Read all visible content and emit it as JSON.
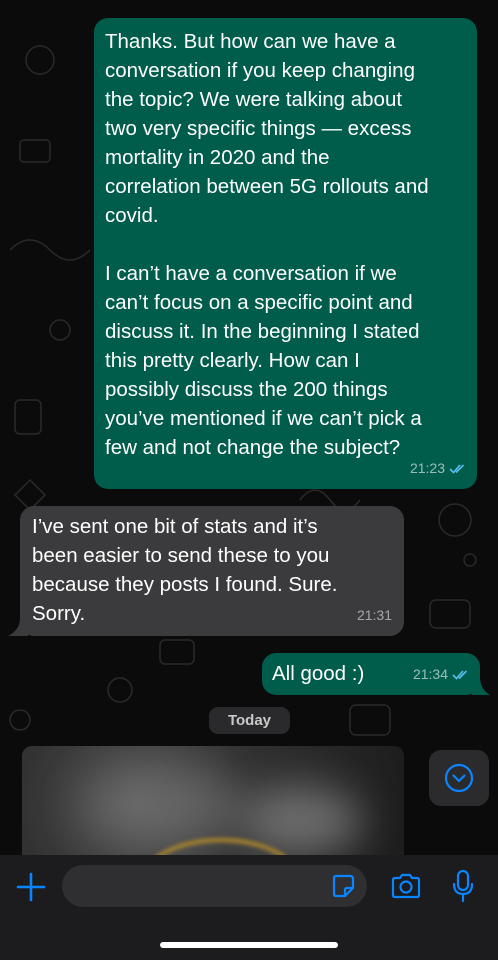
{
  "messages": [
    {
      "direction": "outgoing",
      "text": "Thanks. But how can we have a\nconversation if you keep changing\nthe topic? We were talking about\ntwo very specific things — excess\nmortality in 2020 and the\ncorrelation between 5G rollouts and\ncovid.\n\nI can’t have a conversation if we\ncan’t focus on a specific point and\ndiscuss it. In the beginning I stated\nthis pretty clearly. How can I\npossibly discuss the 200 things\nyou’ve mentioned if we can’t pick a\nfew and not change the subject?",
      "time": "21:23",
      "status": "read"
    },
    {
      "direction": "incoming",
      "text": "I’ve sent one bit of stats and it’s\nbeen easier to send these to you\nbecause they posts I found. Sure.\nSorry.",
      "time": "21:31"
    },
    {
      "direction": "outgoing",
      "text": "All good :)",
      "time": "21:34",
      "status": "read"
    }
  ],
  "date_separator": "Today",
  "composer": {
    "value": "",
    "placeholder": ""
  },
  "icons": {
    "attach": "plus-icon",
    "sticker": "sticker-icon",
    "camera": "camera-icon",
    "mic": "microphone-icon",
    "scroll": "chevron-down-circle-icon",
    "read_receipt": "double-check-icon"
  },
  "colors": {
    "outgoing_bubble": "#005c4b",
    "incoming_bubble": "#3b3b3d",
    "accent": "#0a84ff",
    "read_ticks": "#53bdeb"
  }
}
